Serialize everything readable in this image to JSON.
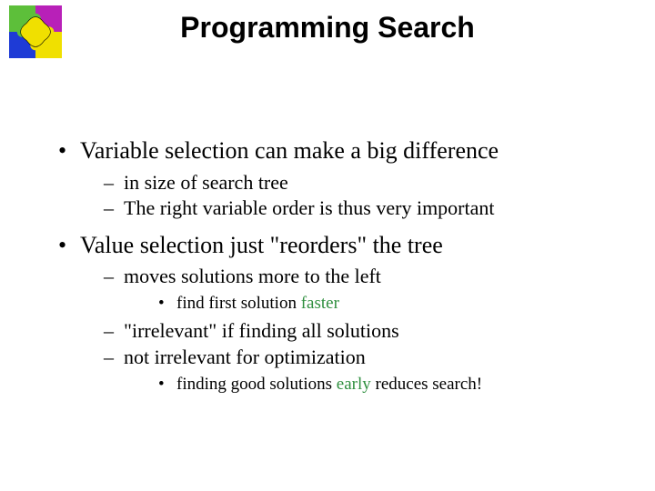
{
  "accent_color": "#2f8f3f",
  "title": "Programming Search",
  "logo_name": "puzzle-logo",
  "bullets": {
    "b1": "Variable selection can make a big difference",
    "b1a": "in size of search tree",
    "b1b": "The right variable order is thus very important",
    "b2": "Value selection just \"reorders\" the tree",
    "b2a": "moves solutions more to the left",
    "b2a1_pre": "find first solution ",
    "b2a1_accent": "faster",
    "b2b": "\"irrelevant\" if finding all solutions",
    "b2c": "not irrelevant for optimization",
    "b2c1_pre": "finding good solutions ",
    "b2c1_accent": "early",
    "b2c1_post": " reduces search!"
  }
}
